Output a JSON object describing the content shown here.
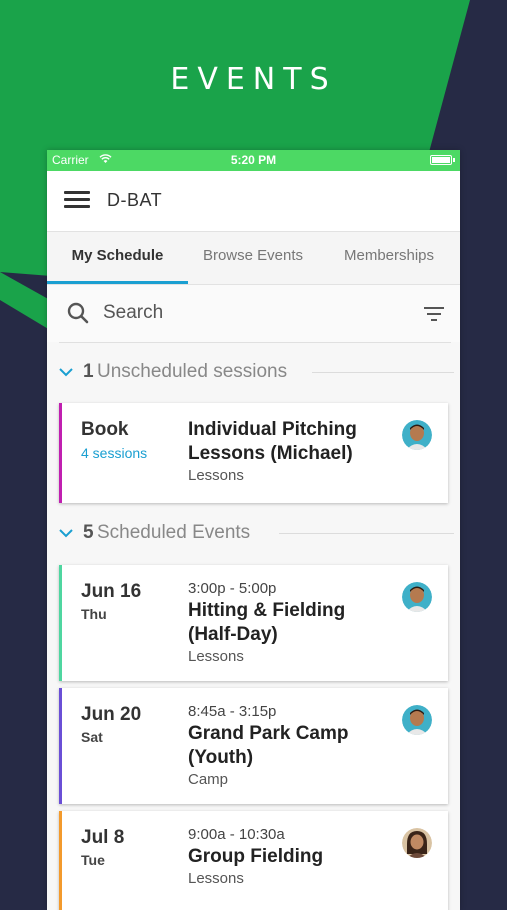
{
  "hero": {
    "title": "EVENTS"
  },
  "status_bar": {
    "carrier": "Carrier",
    "time": "5:20 PM"
  },
  "app_bar": {
    "title": "D-BAT"
  },
  "tabs": [
    {
      "label": "My Schedule",
      "active": true
    },
    {
      "label": "Browse Events",
      "active": false
    },
    {
      "label": "Memberships",
      "active": false
    }
  ],
  "search": {
    "placeholder": "Search"
  },
  "sections": {
    "unscheduled": {
      "count": "1",
      "label": "Unscheduled sessions"
    },
    "scheduled": {
      "count": "5",
      "label": "Scheduled Events"
    }
  },
  "unscheduled_cards": [
    {
      "action": "Book",
      "sessions": "4 sessions",
      "title_line1": "Individual Pitching",
      "title_line2": "Lessons (Michael)",
      "type": "Lessons",
      "accent": "#c01fb0",
      "avatar": "male-avatar"
    }
  ],
  "scheduled_cards": [
    {
      "date": "Jun 16",
      "day": "Thu",
      "time": "3:00p - 5:00p",
      "title_line1": "Hitting & Fielding",
      "title_line2": "(Half-Day)",
      "type": "Lessons",
      "accent": "#4fd6a0",
      "avatar": "male-avatar"
    },
    {
      "date": "Jun 20",
      "day": "Sat",
      "time": "8:45a - 3:15p",
      "title_line1": "Grand Park Camp",
      "title_line2": "(Youth)",
      "type": "Camp",
      "accent": "#6a4fd6",
      "avatar": "male-avatar"
    },
    {
      "date": "Jul 8",
      "day": "Tue",
      "time": "9:00a - 10:30a",
      "title_line1": "Group Fielding",
      "title_line2": "",
      "type": "Lessons",
      "accent": "#f39a2c",
      "avatar": "female-avatar"
    }
  ],
  "colors": {
    "hero_green": "#1aa34a",
    "navy": "#262a45",
    "status_green": "#4cd964",
    "tab_accent": "#1a9fd1"
  }
}
